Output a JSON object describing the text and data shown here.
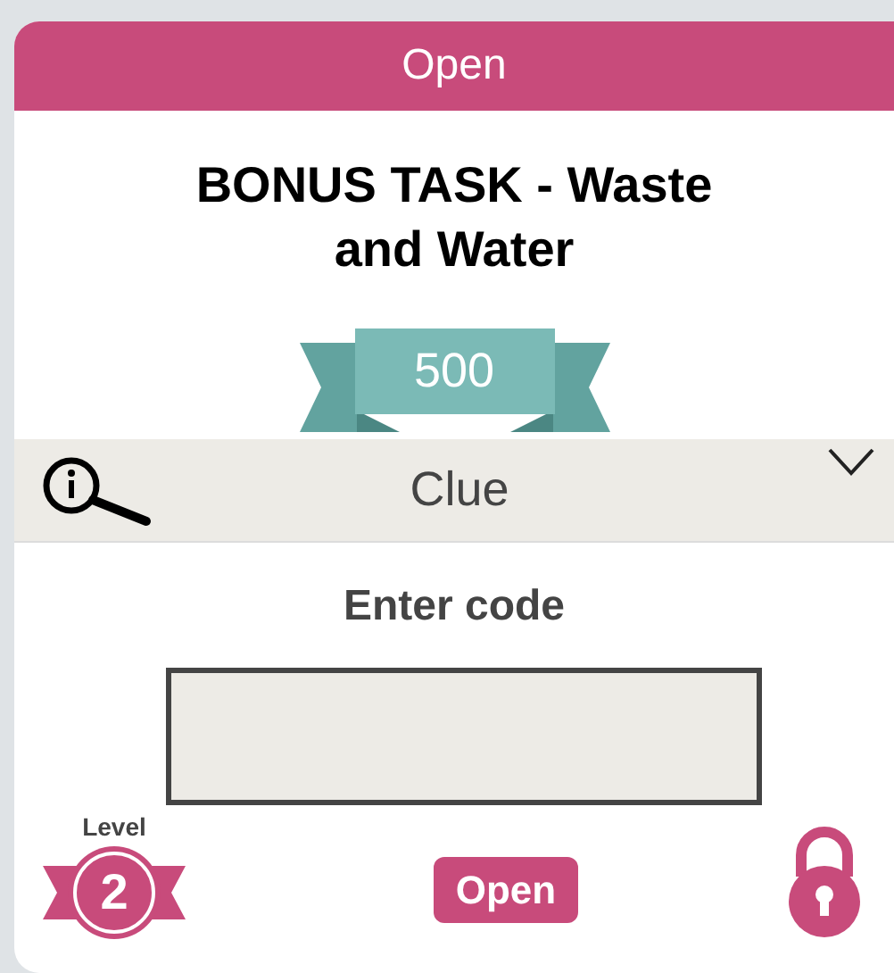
{
  "header": {
    "title": "Open"
  },
  "task": {
    "title": "BONUS TASK - Waste and Water",
    "points": "500"
  },
  "clue": {
    "label": "Clue",
    "expanded": false
  },
  "code": {
    "label": "Enter code"
  },
  "level": {
    "label": "Level",
    "value": "2"
  },
  "submit": {
    "label": "Open"
  },
  "lock": {
    "locked": true
  }
}
